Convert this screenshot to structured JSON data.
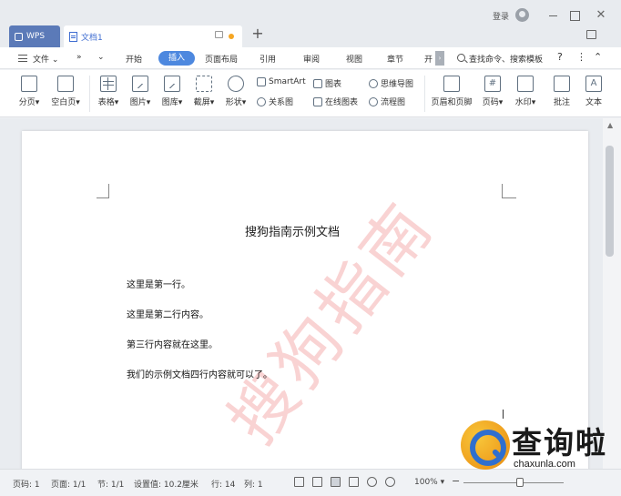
{
  "window": {
    "app_tab": "WPS",
    "doc_tab": "文档1",
    "login_label": "登录"
  },
  "menu": {
    "file": "文件",
    "tabs": [
      "开始",
      "插入",
      "页面布局",
      "引用",
      "审阅",
      "视图",
      "章节",
      "开"
    ],
    "active_tab": "插入",
    "search_label": "查找命令、搜索模板"
  },
  "ribbon": {
    "page_break": "分页",
    "blank_page": "空白页",
    "table": "表格",
    "picture": "图片",
    "gallery": "图库",
    "screenshot": "截屏",
    "shape": "形状",
    "smartart": "SmartArt",
    "relation": "关系图",
    "chart": "图表",
    "online_chart": "在线图表",
    "mindmap": "思维导图",
    "flowchart": "流程图",
    "header_footer": "页眉和页脚",
    "page_number": "页码",
    "watermark": "水印",
    "comment": "批注",
    "textbox": "文本"
  },
  "document": {
    "title": "搜狗指南示例文档",
    "lines": [
      "这里是第一行。",
      "这里是第二行内容。",
      "第三行内容就在这里。",
      "我们的示例文档四行内容就可以了。"
    ],
    "watermark_text": "搜狗指南"
  },
  "status": {
    "page_no": "页码: 1",
    "pages": "页面: 1/1",
    "section": "节: 1/1",
    "setting": "设置值: 10.2厘米",
    "row": "行: 14",
    "col": "列: 1",
    "zoom": "100%"
  },
  "logo": {
    "text": "查询啦",
    "url": "chaxunla.com"
  }
}
